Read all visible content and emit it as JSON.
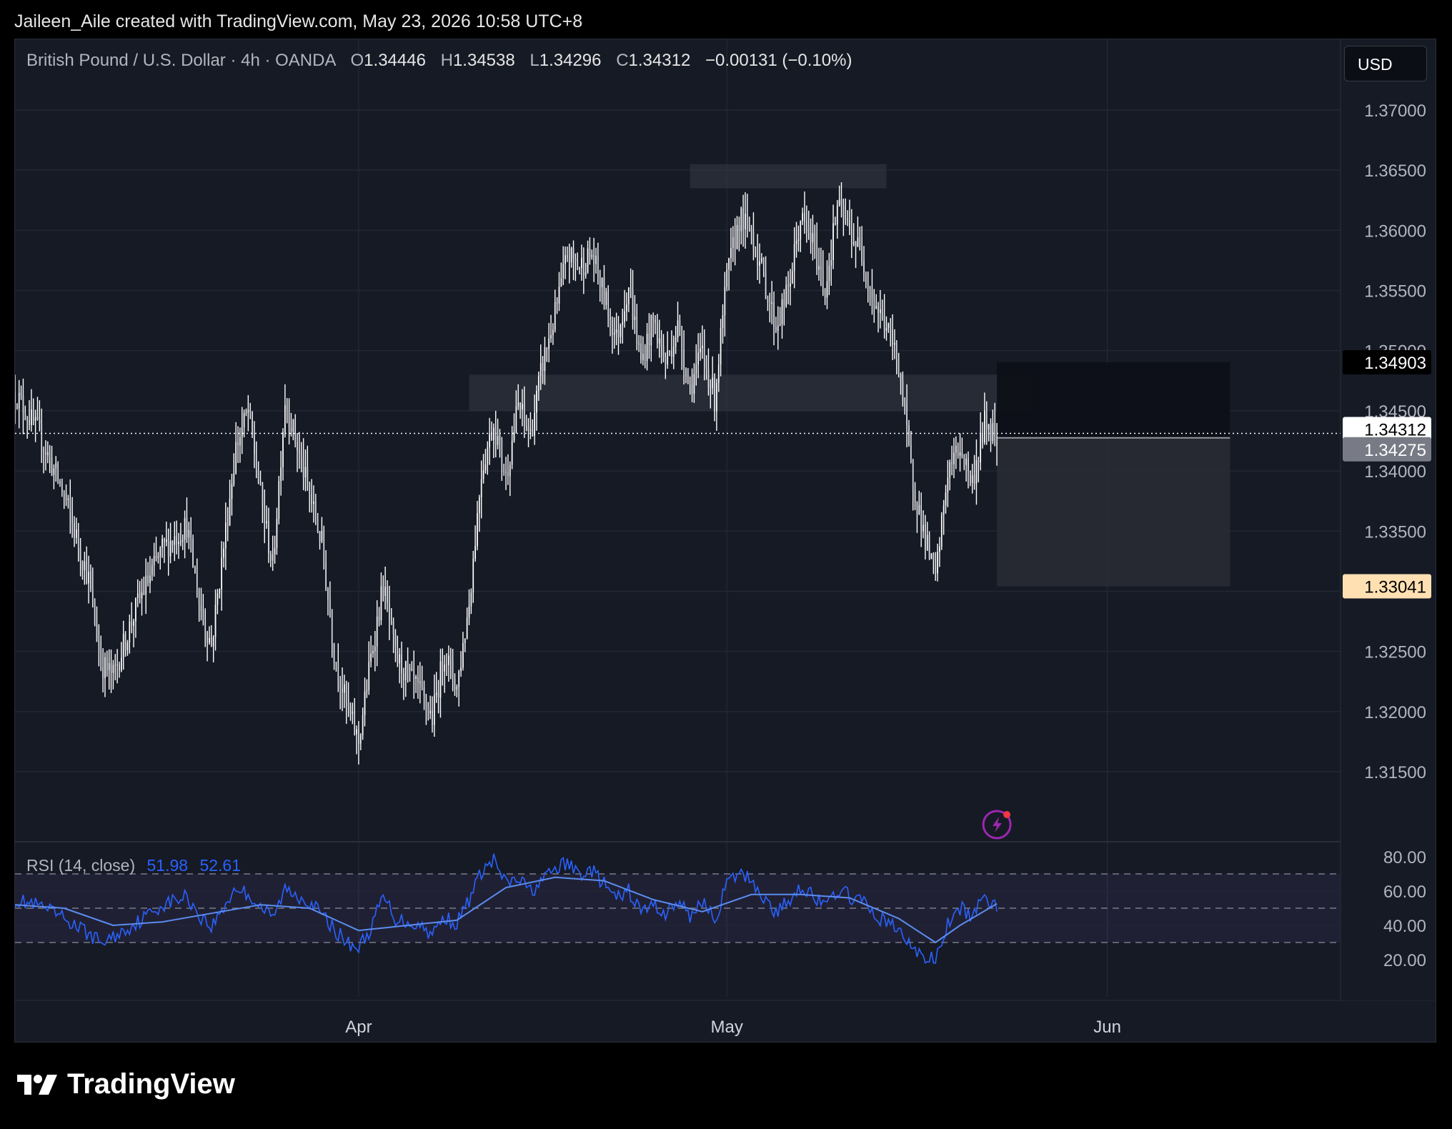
{
  "header": {
    "attribution": "Jaileen_Aile created with TradingView.com, May 23, 2026 10:58 UTC+8"
  },
  "legend": {
    "symbol": "British Pound / U.S. Dollar · 4h · OANDA",
    "open_label": "O",
    "open": "1.34446",
    "high_label": "H",
    "high": "1.34538",
    "low_label": "L",
    "low": "1.34296",
    "close_label": "C",
    "close": "1.34312",
    "change": "−0.00131 (−0.10%)"
  },
  "currency": "USD",
  "rsi_legend": {
    "label": "RSI (14, close)",
    "rsi": "51.98",
    "ma": "52.61"
  },
  "footer": {
    "brand": "TradingView"
  },
  "colors": {
    "background": "#161a25",
    "candle": "#ffffff",
    "wick": "#ffffff",
    "rsi_line": "#2962ff",
    "rsi_ma": "#5b8def",
    "zone": "#363a45",
    "long_box_target": "#0d1017",
    "long_box_stop": "#2a2d35",
    "target_price_tag": "#000000",
    "stop_price_tag": "#ffe0b2",
    "current_price_tag": "#ffffff",
    "entry_price_tag": "#787b86",
    "alert_icon": "#9c27b0"
  },
  "chart_data": [
    {
      "type": "candlestick",
      "title": "British Pound / U.S. Dollar · 4h · OANDA",
      "ylim": [
        1.3145,
        1.3745
      ],
      "yticks": [
        "1.37000",
        "1.36500",
        "1.36000",
        "1.35500",
        "1.35000",
        "1.34500",
        "1.34000",
        "1.33500",
        "1.33000",
        "1.32500",
        "1.32000",
        "1.31500"
      ],
      "xticks": [
        "Apr",
        "May",
        "Jun"
      ],
      "x_range": [
        "2026-03-04",
        "2026-06-20"
      ],
      "close_path": [
        [
          "2026-03-04",
          1.3465
        ],
        [
          "2026-03-06",
          1.343
        ],
        [
          "2026-03-08",
          1.338
        ],
        [
          "2026-03-10",
          1.331
        ],
        [
          "2026-03-11",
          1.324
        ],
        [
          "2026-03-12",
          1.323
        ],
        [
          "2026-03-14",
          1.329
        ],
        [
          "2026-03-16",
          1.3335
        ],
        [
          "2026-03-18",
          1.3355
        ],
        [
          "2026-03-19",
          1.329
        ],
        [
          "2026-03-20",
          1.3255
        ],
        [
          "2026-03-22",
          1.342
        ],
        [
          "2026-03-23",
          1.345
        ],
        [
          "2026-03-24",
          1.338
        ],
        [
          "2026-03-25",
          1.332
        ],
        [
          "2026-03-26",
          1.346
        ],
        [
          "2026-03-27",
          1.342
        ],
        [
          "2026-03-29",
          1.334
        ],
        [
          "2026-03-30",
          1.325
        ],
        [
          "2026-03-31",
          1.3205
        ],
        [
          "2026-04-01",
          1.3175
        ],
        [
          "2026-04-02",
          1.3245
        ],
        [
          "2026-04-03",
          1.3305
        ],
        [
          "2026-04-04",
          1.3245
        ],
        [
          "2026-04-06",
          1.3215
        ],
        [
          "2026-04-07",
          1.3195
        ],
        [
          "2026-04-08",
          1.325
        ],
        [
          "2026-04-09",
          1.322
        ],
        [
          "2026-04-10",
          1.329
        ],
        [
          "2026-04-11",
          1.34
        ],
        [
          "2026-04-12",
          1.344
        ],
        [
          "2026-04-13",
          1.3395
        ],
        [
          "2026-04-14",
          1.3455
        ],
        [
          "2026-04-15",
          1.343
        ],
        [
          "2026-04-16",
          1.349
        ],
        [
          "2026-04-17",
          1.353
        ],
        [
          "2026-04-18",
          1.358
        ],
        [
          "2026-04-19",
          1.357
        ],
        [
          "2026-04-20",
          1.358
        ],
        [
          "2026-04-21",
          1.3545
        ],
        [
          "2026-04-22",
          1.351
        ],
        [
          "2026-04-23",
          1.3555
        ],
        [
          "2026-04-24",
          1.349
        ],
        [
          "2026-04-25",
          1.3525
        ],
        [
          "2026-04-26",
          1.349
        ],
        [
          "2026-04-27",
          1.352
        ],
        [
          "2026-04-28",
          1.347
        ],
        [
          "2026-04-29",
          1.35
        ],
        [
          "2026-04-30",
          1.346
        ],
        [
          "2026-05-01",
          1.356
        ],
        [
          "2026-05-02",
          1.361
        ],
        [
          "2026-05-03",
          1.36
        ],
        [
          "2026-05-04",
          1.356
        ],
        [
          "2026-05-05",
          1.352
        ],
        [
          "2026-05-06",
          1.355
        ],
        [
          "2026-05-07",
          1.361
        ],
        [
          "2026-05-08",
          1.359
        ],
        [
          "2026-05-09",
          1.355
        ],
        [
          "2026-05-10",
          1.362
        ],
        [
          "2026-05-11",
          1.36
        ],
        [
          "2026-05-12",
          1.358
        ],
        [
          "2026-05-13",
          1.354
        ],
        [
          "2026-05-14",
          1.352
        ],
        [
          "2026-05-15",
          1.349
        ],
        [
          "2026-05-16",
          1.34
        ],
        [
          "2026-05-17",
          1.335
        ],
        [
          "2026-05-18",
          1.331
        ],
        [
          "2026-05-19",
          1.34
        ],
        [
          "2026-05-20",
          1.342
        ],
        [
          "2026-05-21",
          1.339
        ],
        [
          "2026-05-22",
          1.344
        ],
        [
          "2026-05-23",
          1.34312
        ]
      ]
    },
    {
      "type": "line",
      "title": "RSI (14, close)",
      "ylim": [
        15,
        85
      ],
      "yticks": [
        "80.00",
        "60.00",
        "40.00",
        "20.00"
      ],
      "bands": [
        30,
        50,
        70
      ],
      "series": [
        {
          "name": "RSI",
          "values_by_date": [
            [
              "2026-03-04",
              55
            ],
            [
              "2026-03-06",
              51
            ],
            [
              "2026-03-08",
              44
            ],
            [
              "2026-03-10",
              35
            ],
            [
              "2026-03-11",
              30
            ],
            [
              "2026-03-12",
              33
            ],
            [
              "2026-03-14",
              42
            ],
            [
              "2026-03-16",
              52
            ],
            [
              "2026-03-18",
              57
            ],
            [
              "2026-03-19",
              46
            ],
            [
              "2026-03-20",
              39
            ],
            [
              "2026-03-22",
              62
            ],
            [
              "2026-03-23",
              58
            ],
            [
              "2026-03-25",
              44
            ],
            [
              "2026-03-26",
              61
            ],
            [
              "2026-03-28",
              54
            ],
            [
              "2026-03-30",
              38
            ],
            [
              "2026-03-31",
              30
            ],
            [
              "2026-04-01",
              27
            ],
            [
              "2026-04-02",
              38
            ],
            [
              "2026-04-03",
              57
            ],
            [
              "2026-04-04",
              44
            ],
            [
              "2026-04-06",
              40
            ],
            [
              "2026-04-07",
              35
            ],
            [
              "2026-04-08",
              45
            ],
            [
              "2026-04-09",
              41
            ],
            [
              "2026-04-10",
              55
            ],
            [
              "2026-04-11",
              71
            ],
            [
              "2026-04-12",
              78
            ],
            [
              "2026-04-13",
              64
            ],
            [
              "2026-04-14",
              67
            ],
            [
              "2026-04-15",
              60
            ],
            [
              "2026-04-16",
              66
            ],
            [
              "2026-04-17",
              73
            ],
            [
              "2026-04-18",
              76
            ],
            [
              "2026-04-19",
              70
            ],
            [
              "2026-04-20",
              72
            ],
            [
              "2026-04-21",
              64
            ],
            [
              "2026-04-22",
              55
            ],
            [
              "2026-04-23",
              60
            ],
            [
              "2026-04-24",
              48
            ],
            [
              "2026-04-25",
              52
            ],
            [
              "2026-04-26",
              47
            ],
            [
              "2026-04-27",
              54
            ],
            [
              "2026-04-28",
              45
            ],
            [
              "2026-04-29",
              55
            ],
            [
              "2026-04-30",
              43
            ],
            [
              "2026-05-01",
              64
            ],
            [
              "2026-05-02",
              70
            ],
            [
              "2026-05-03",
              67
            ],
            [
              "2026-05-04",
              56
            ],
            [
              "2026-05-05",
              47
            ],
            [
              "2026-05-06",
              54
            ],
            [
              "2026-05-07",
              63
            ],
            [
              "2026-05-08",
              58
            ],
            [
              "2026-05-09",
              50
            ],
            [
              "2026-05-10",
              61
            ],
            [
              "2026-05-11",
              57
            ],
            [
              "2026-05-12",
              54
            ],
            [
              "2026-05-13",
              46
            ],
            [
              "2026-05-14",
              42
            ],
            [
              "2026-05-15",
              37
            ],
            [
              "2026-05-16",
              28
            ],
            [
              "2026-05-17",
              21
            ],
            [
              "2026-05-18",
              20
            ],
            [
              "2026-05-19",
              40
            ],
            [
              "2026-05-20",
              50
            ],
            [
              "2026-05-21",
              45
            ],
            [
              "2026-05-22",
              56
            ],
            [
              "2026-05-23",
              51.98
            ]
          ]
        },
        {
          "name": "RSI-based MA",
          "values_by_date": [
            [
              "2026-03-04",
              52
            ],
            [
              "2026-03-08",
              50
            ],
            [
              "2026-03-12",
              40
            ],
            [
              "2026-03-16",
              42
            ],
            [
              "2026-03-20",
              47
            ],
            [
              "2026-03-24",
              52
            ],
            [
              "2026-03-28",
              50
            ],
            [
              "2026-04-01",
              37
            ],
            [
              "2026-04-05",
              40
            ],
            [
              "2026-04-09",
              43
            ],
            [
              "2026-04-13",
              62
            ],
            [
              "2026-04-17",
              68
            ],
            [
              "2026-04-21",
              66
            ],
            [
              "2026-04-25",
              55
            ],
            [
              "2026-04-29",
              48
            ],
            [
              "2026-05-03",
              58
            ],
            [
              "2026-05-07",
              58
            ],
            [
              "2026-05-11",
              56
            ],
            [
              "2026-05-15",
              44
            ],
            [
              "2026-05-18",
              30
            ],
            [
              "2026-05-20",
              40
            ],
            [
              "2026-05-23",
              52.61
            ]
          ]
        }
      ]
    }
  ],
  "drawings": {
    "resistance_zone_top": {
      "price_high": 1.3655,
      "price_low": 1.3635,
      "from": "2026-04-28",
      "to": "2026-05-14"
    },
    "resistance_zone_mid": {
      "price_high": 1.348,
      "price_low": 1.345,
      "from": "2026-04-10",
      "to": "2026-05-26"
    },
    "position_tool": {
      "entry": 1.34275,
      "target": 1.34903,
      "stop": 1.33041,
      "from": "2026-05-23",
      "to": "2026-06-11"
    },
    "price_tags": {
      "target": "1.34903",
      "current": "1.34312",
      "entry": "1.34275",
      "stop": "1.33041"
    }
  }
}
